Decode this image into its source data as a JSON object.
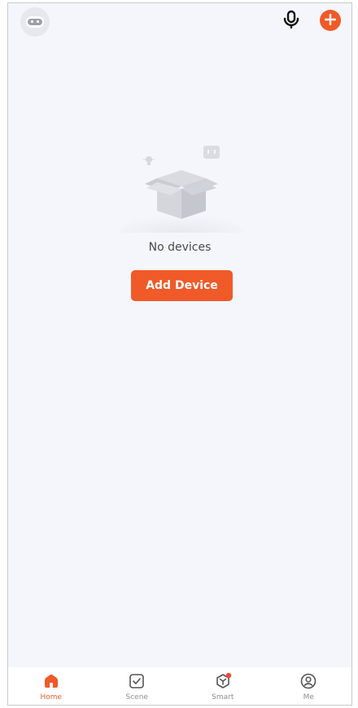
{
  "header": {
    "avatar_icon": "robot-face-icon",
    "mic_icon": "microphone-icon",
    "add_icon": "plus-icon"
  },
  "empty_state": {
    "illustration": "empty-box-icon",
    "message": "No devices",
    "button_label": "Add Device"
  },
  "tabbar": {
    "tabs": [
      {
        "label": "Home",
        "icon": "home-icon",
        "active": true
      },
      {
        "label": "Scene",
        "icon": "scene-check-icon",
        "active": false
      },
      {
        "label": "Smart",
        "icon": "smart-cube-icon",
        "active": false,
        "badge": true
      },
      {
        "label": "Me",
        "icon": "profile-icon",
        "active": false
      }
    ]
  },
  "colors": {
    "accent": "#f05a28",
    "background": "#f4f6fb",
    "tab_inactive": "#8e8e93"
  }
}
